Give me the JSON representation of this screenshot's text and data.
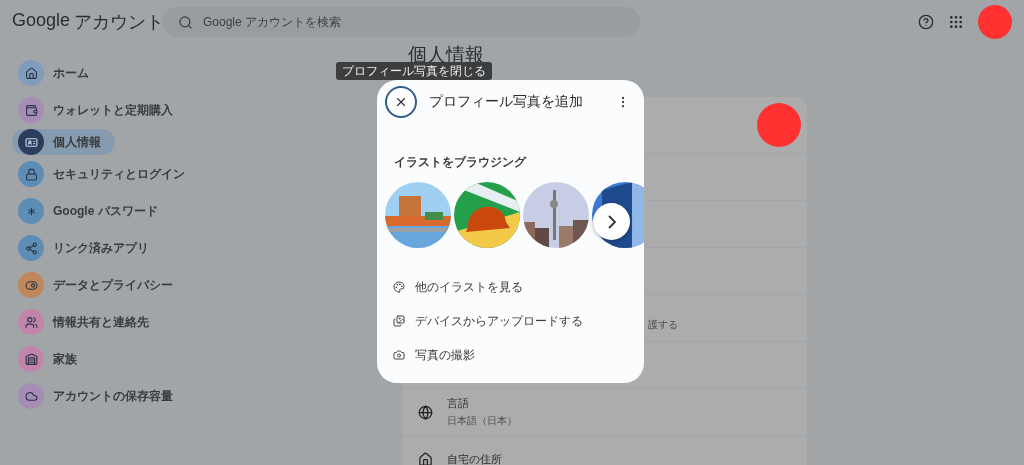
{
  "header": {
    "logo": "Google",
    "product": "アカウント",
    "search": {
      "placeholder": "Google アカウントを検索"
    }
  },
  "sidebar": {
    "items": [
      {
        "label": "ホーム",
        "kind": "home",
        "color": "#7f9cbd",
        "selected": false
      },
      {
        "label": "ウォレットと定期購入",
        "kind": "wallet",
        "color": "#a58db5",
        "selected": false
      },
      {
        "label": "個人情報",
        "kind": "id",
        "color": "#2b3d5c",
        "selected": true
      },
      {
        "label": "セキュリティとログイン",
        "kind": "lock",
        "color": "#5d8db5",
        "selected": false
      },
      {
        "label": "Google パスワード",
        "kind": "password",
        "color": "#5d8db5",
        "selected": false
      },
      {
        "label": "リンク済みアプリ",
        "kind": "apps",
        "color": "#5d8db5",
        "selected": false
      },
      {
        "label": "データとプライバシー",
        "kind": "toggle",
        "color": "#c0875c",
        "selected": false
      },
      {
        "label": "情報共有と連絡先",
        "kind": "people",
        "color": "#c185ac",
        "selected": false
      },
      {
        "label": "家族",
        "kind": "family",
        "color": "#c185ac",
        "selected": false
      },
      {
        "label": "アカウントの保存容量",
        "kind": "cloud",
        "color": "#a58db5",
        "selected": false
      }
    ]
  },
  "main": {
    "title": "個人情報",
    "rows": [
      {
        "kind": "avatar"
      },
      {
        "kind": "blank"
      },
      {
        "kind": "blank"
      },
      {
        "kind": "blank"
      },
      {
        "kind": "partial",
        "description": "護する"
      },
      {
        "kind": "blank"
      },
      {
        "kind": "language",
        "title": "言語",
        "value": "日本語（日本）"
      },
      {
        "kind": "address",
        "title": "自宅の住所"
      }
    ]
  },
  "tooltip": "プロフィール写真を閉じる",
  "dialog": {
    "title": "プロフィール写真を追加",
    "section": "イラストをブラウジング",
    "options": [
      {
        "label": "他のイラストを見る",
        "kind": "palette"
      },
      {
        "label": "デバイスからアップロードする",
        "kind": "upload"
      },
      {
        "label": "写真の撮影",
        "kind": "camera"
      }
    ]
  }
}
